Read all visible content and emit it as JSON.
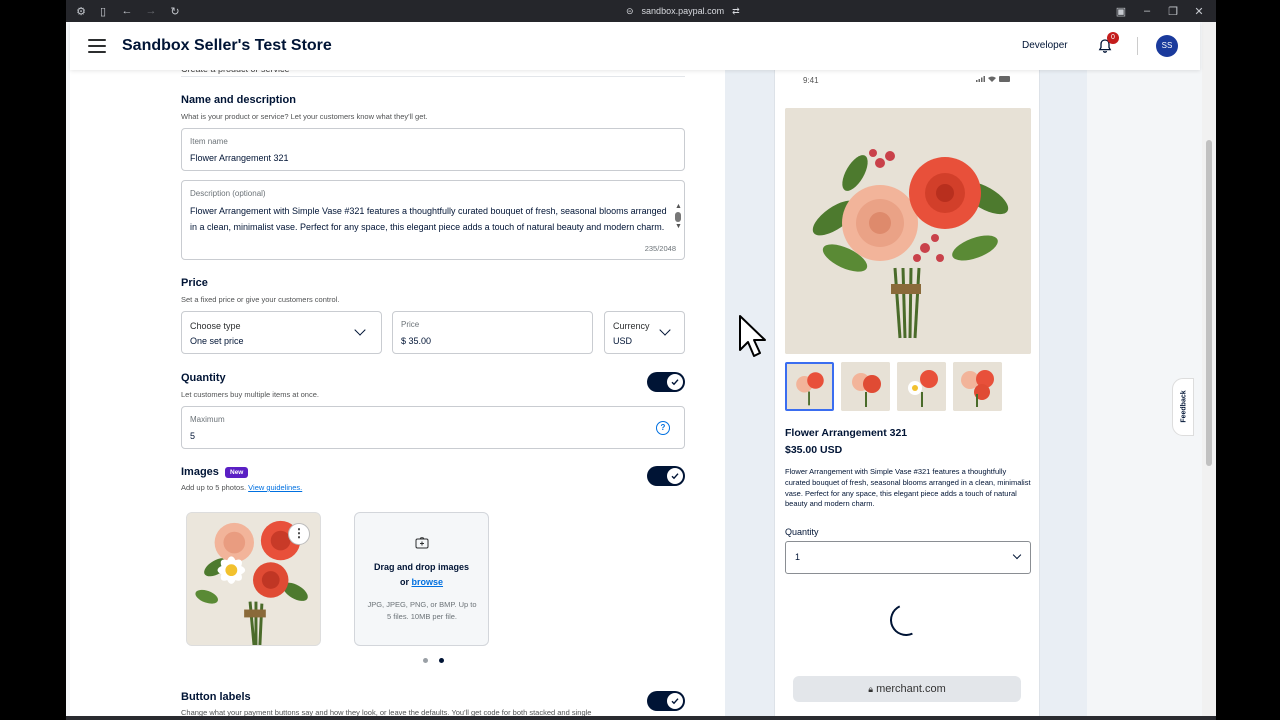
{
  "browser": {
    "url": "sandbox.paypal.com"
  },
  "topnav": {
    "store_title": "Sandbox Seller's Test Store",
    "developer_link": "Developer",
    "notification_count": "0",
    "avatar_initials": "SS"
  },
  "form": {
    "sub_hint": "Create a product or service",
    "name_section": {
      "title": "Name and description",
      "description": "What is your product or service? Let your customers know what they'll get.",
      "item_name_label": "Item name",
      "item_name_value": "Flower Arrangement 321",
      "description_label": "Description (optional)",
      "description_value": "Flower Arrangement with Simple Vase #321 features a thoughtfully curated bouquet of fresh, seasonal blooms arranged in a clean, minimalist vase. Perfect for any space, this elegant piece adds a touch of natural beauty and modern charm.",
      "char_count": "235/2048"
    },
    "price_section": {
      "title": "Price",
      "description": "Set a fixed price or give your customers control.",
      "type_label": "Choose type",
      "type_value": "One set price",
      "price_label": "Price",
      "price_value": "$ 35.00",
      "currency_label": "Currency",
      "currency_value": "USD"
    },
    "quantity_section": {
      "title": "Quantity",
      "description": "Let customers buy multiple items at once.",
      "enabled": true,
      "max_label": "Maximum",
      "max_value": "5"
    },
    "images_section": {
      "title": "Images",
      "badge": "New",
      "description": "Add up to 5 photos.",
      "guidelines_link": "View guidelines.",
      "enabled": true,
      "drop_title": "Drag and drop images",
      "drop_or": "or",
      "drop_browse": "browse",
      "drop_note": "JPG, JPEG, PNG, or BMP. Up to 5 files. 10MB per file."
    },
    "button_labels_section": {
      "title": "Button labels",
      "description": "Change what your payment buttons say and how they look, or leave the defaults. You'll get code for both stacked and single",
      "enabled": true
    }
  },
  "preview": {
    "time": "9:41",
    "product_title": "Flower Arrangement 321",
    "product_price": "$35.00 USD",
    "product_description": "Flower Arrangement with Simple Vase #321 features a thoughtfully curated bouquet of fresh, seasonal blooms arranged in a clean, minimalist vase. Perfect for any space, this elegant piece adds a touch of natural beauty and modern charm.",
    "quantity_label": "Quantity",
    "quantity_value": "1",
    "url": "merchant.com"
  },
  "feedback_tab": "Feedback",
  "colors": {
    "accent": "#0070e0",
    "navy": "#001435",
    "badge_purple": "#5a1fc4",
    "notification_red": "#c41c1c"
  }
}
